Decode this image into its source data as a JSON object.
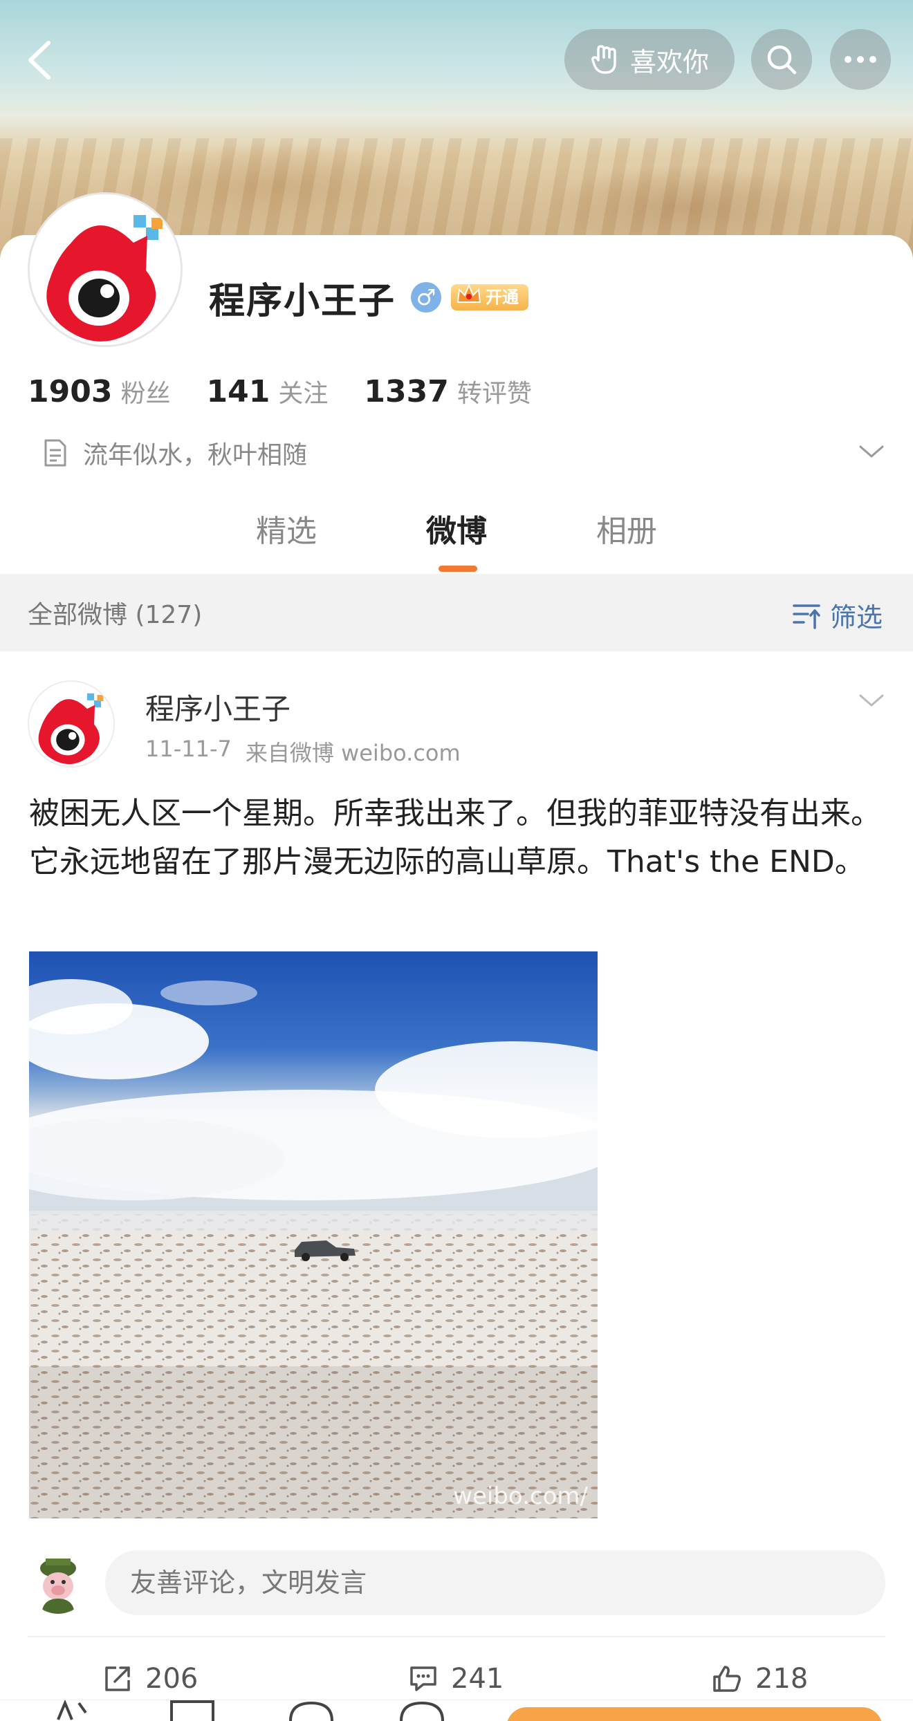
{
  "header": {
    "back_icon": "chevron-left-icon",
    "like_label": "喜欢你",
    "like_icon": "hand-wave-icon",
    "search_icon": "search-icon",
    "more_icon": "ellipsis-icon"
  },
  "profile": {
    "name": "程序小王子",
    "gender_symbol": "♂",
    "vip_label": "开通",
    "stats": [
      {
        "value": "1903",
        "label": "粉丝"
      },
      {
        "value": "141",
        "label": "关注"
      },
      {
        "value": "1337",
        "label": "转评赞"
      }
    ],
    "bio": "流年似水，秋叶相随",
    "tabs": [
      {
        "label": "精选",
        "active": false
      },
      {
        "label": "微博",
        "active": true
      },
      {
        "label": "相册",
        "active": false
      }
    ]
  },
  "filter": {
    "title": "全部微博 (127)",
    "button_label": "筛选"
  },
  "post": {
    "author": "程序小王子",
    "date": "11-11-7",
    "source": "来自微博 weibo.com",
    "text": "被困无人区一个星期。所幸我出来了。但我的菲亚特没有出来。它永远地留在了那片漫无边际的高山草原。That's the END。",
    "photo_watermark": "weibo.com/",
    "comment_placeholder": "友善评论，文明发言",
    "actions": {
      "reposts": "206",
      "comments": "241",
      "likes": "218"
    }
  },
  "colors": {
    "accent_orange": "#f07a31",
    "link_blue": "#4a74ab",
    "weibo_red": "#e6162d"
  }
}
